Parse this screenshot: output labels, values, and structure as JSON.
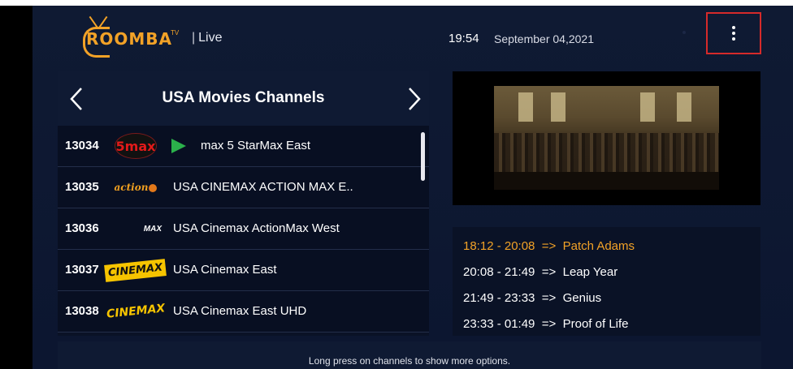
{
  "header": {
    "logo_text": "ROOMBA",
    "logo_tv": "TV",
    "section": "Live",
    "time": "19:54",
    "date": "September 04,2021",
    "menu_icon": "more-vertical-icon"
  },
  "channel_list": {
    "title": "USA Movies Channels",
    "prev_icon": "chevron-left-icon",
    "next_icon": "chevron-right-icon",
    "channels": [
      {
        "number": "13034",
        "logo": "5max",
        "name": "max 5 StarMax East",
        "playing": true
      },
      {
        "number": "13035",
        "logo": "action",
        "name": "USA CINEMAX ACTION MAX E..",
        "playing": false
      },
      {
        "number": "13036",
        "logo": "MAX",
        "name": "USA Cinemax ActionMax West",
        "playing": false
      },
      {
        "number": "13037",
        "logo": "CINEMAX",
        "name": "USA Cinemax East",
        "playing": false
      },
      {
        "number": "13038",
        "logo": "CINEMAX",
        "name": "USA Cinemax East UHD",
        "playing": false
      }
    ]
  },
  "epg": [
    {
      "time": "18:12 - 20:08",
      "arrow": "=>",
      "title": "Patch Adams",
      "current": true
    },
    {
      "time": "20:08 - 21:49",
      "arrow": "=>",
      "title": "Leap Year",
      "current": false
    },
    {
      "time": "21:49 - 23:33",
      "arrow": "=>",
      "title": "Genius",
      "current": false
    },
    {
      "time": "23:33 - 01:49",
      "arrow": "=>",
      "title": "Proof of Life",
      "current": false
    }
  ],
  "footer": {
    "hint": "Long press on channels to show more options."
  },
  "colors": {
    "accent": "#f2a227",
    "highlight_border": "#d62a2a",
    "play": "#2bb14b",
    "background": "#0f1a33"
  }
}
